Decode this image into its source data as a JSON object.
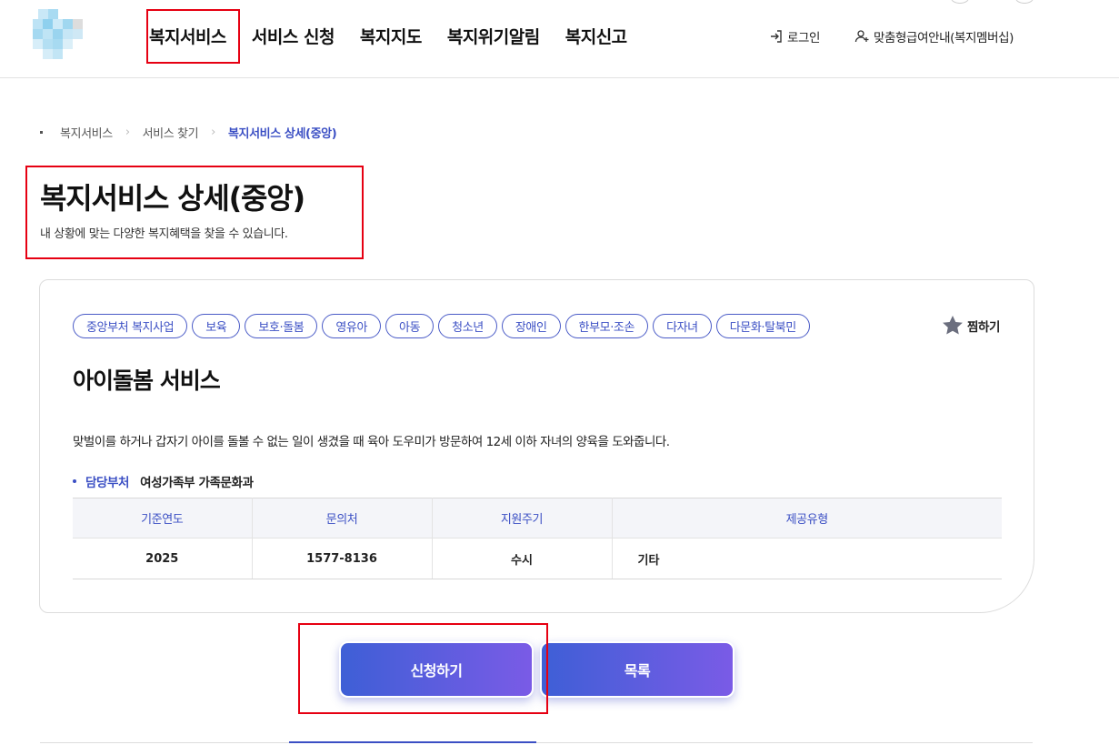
{
  "header": {
    "logo": "logo",
    "nav": [
      "복지서비스",
      "서비스 신청",
      "복지지도",
      "복지위기알림",
      "복지신고"
    ],
    "login_label": "로그인",
    "membership_label": "맞춤형급여안내(복지멤버십)",
    "login_icon": "login-icon",
    "membership_icon": "user-add-icon"
  },
  "breadcrumb": [
    "복지서비스",
    "서비스 찾기",
    "복지서비스 상세(중앙)"
  ],
  "page": {
    "title": "복지서비스 상세(중앙)",
    "subtitle": "내 상황에 맞는 다양한 복지혜택을 찾을 수 있습니다."
  },
  "service": {
    "tags": [
      "중앙부처 복지사업",
      "보육",
      "보호·돌봄",
      "영유아",
      "아동",
      "청소년",
      "장애인",
      "한부모·조손",
      "다자녀",
      "다문화·탈북민"
    ],
    "favorite_label": "찜하기",
    "favorite_icon": "star-icon",
    "title": "아이돌봄 서비스",
    "description": "맞벌이를 하거나 갑자기 아이를 돌볼 수 없는 일이 생겼을 때 육아 도우미가 방문하여 12세 이하 자녀의 양육을 도와줍니다.",
    "dept_label": "담당부처",
    "dept_value": "여성가족부 가족문화과",
    "table": {
      "headers": [
        "기준연도",
        "문의처",
        "지원주기",
        "제공유형"
      ],
      "row": [
        "2025",
        "1577-8136",
        "수시",
        "기타"
      ]
    }
  },
  "actions": {
    "apply_label": "신청하기",
    "list_label": "목록"
  },
  "colors": {
    "accent": "#3b4fc4",
    "highlight_box": "#e60012",
    "button_gradient_start": "#3e5fd6",
    "button_gradient_end": "#7a5be6"
  }
}
